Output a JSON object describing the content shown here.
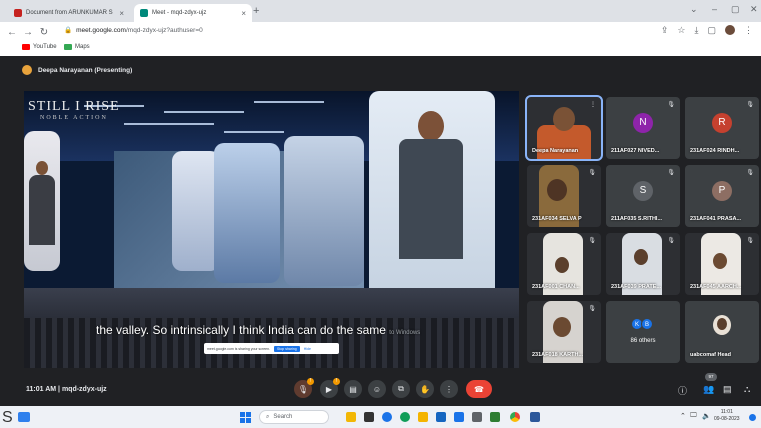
{
  "browser": {
    "tabs": [
      {
        "title": "Document from ARUNKUMAR S",
        "close": "×"
      },
      {
        "title": "Meet - mqd-zdyx-ujz",
        "close": "×",
        "extra": "🔈"
      }
    ],
    "new_tab": "+",
    "url_host": "meet.google.com",
    "url_path": "/mqd-zdyx-ujz?authuser=0",
    "bookmarks": [
      {
        "label": "YouTube",
        "color": "#ff0000"
      },
      {
        "label": "Maps",
        "color": "#34a853"
      }
    ],
    "window_controls": [
      "⌄",
      "–",
      "▢",
      "✕"
    ]
  },
  "meeting": {
    "presenter": "Deepa Narayanan (Presenting)",
    "meeting_time": "11:01 AM",
    "meeting_code": "mqd-zdyx-ujz",
    "participant_count": "97"
  },
  "presentation": {
    "logo": "STILL I RISE",
    "logo_sub": "NOBLE ACTION",
    "caption": "the valley. So intrinsically I think India can do the same",
    "caption_tail": "to Windows",
    "share_banner": {
      "text": "meet.google.com is sharing your screen.",
      "stop": "Stop sharing",
      "hide": "Hide"
    }
  },
  "participants": [
    {
      "name": "Deepa Narayanan",
      "type": "video",
      "speaking": true
    },
    {
      "name": "211AF027 NIVED...",
      "type": "avatar",
      "initial": "N",
      "color": "#8e24aa"
    },
    {
      "name": "231AF024 RINDH...",
      "type": "avatar",
      "initial": "R",
      "color": "#c5412f"
    },
    {
      "name": "231AF034 SELVA P",
      "type": "video"
    },
    {
      "name": "211AF035 S.RITHI...",
      "type": "avatar",
      "initial": "S",
      "color": "#5f6368"
    },
    {
      "name": "231AF041 PRASA...",
      "type": "avatar",
      "initial": "P",
      "color": "#8d6e63"
    },
    {
      "name": "231AF001 CHAN...",
      "type": "video"
    },
    {
      "name": "231AF039 PRATE...",
      "type": "video"
    },
    {
      "name": "231AF045 AARCH...",
      "type": "video"
    },
    {
      "name": "231AF018 KARTH...",
      "type": "video"
    },
    {
      "name": "86 others",
      "type": "others",
      "initials": [
        "K",
        "B"
      ]
    },
    {
      "name": "uabcomaf Head",
      "type": "video"
    }
  ],
  "taskbar": {
    "search_placeholder": "Search",
    "time": "11:01",
    "date": "09-08-2023",
    "start_letter": "S"
  }
}
